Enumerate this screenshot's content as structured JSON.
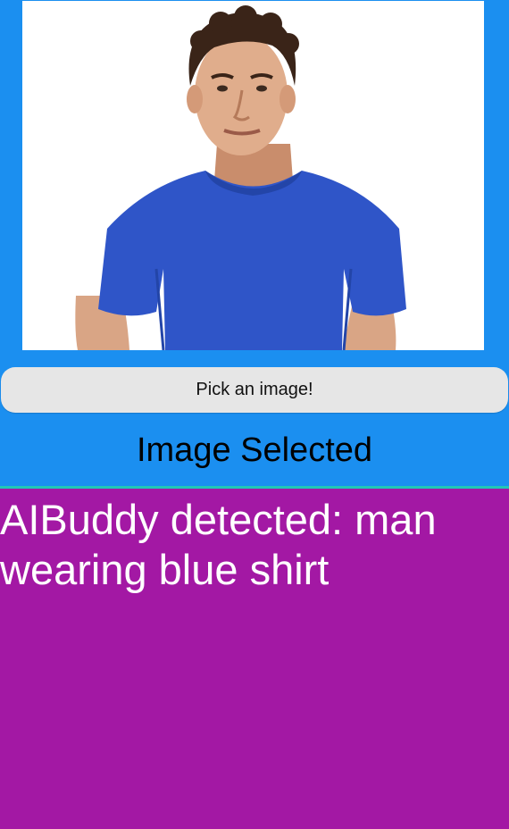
{
  "pick_button": {
    "label": "Pick an image!"
  },
  "status": {
    "text": "Image Selected"
  },
  "result": {
    "text": "AIBuddy detected: man wearing blue shirt"
  },
  "colors": {
    "top_panel": "#1b8ff0",
    "result_panel": "#a318a4",
    "divider": "#21c6b7",
    "button_bg": "#e6e6e6"
  },
  "photo": {
    "subject": "man-in-blue-shirt-photo"
  }
}
